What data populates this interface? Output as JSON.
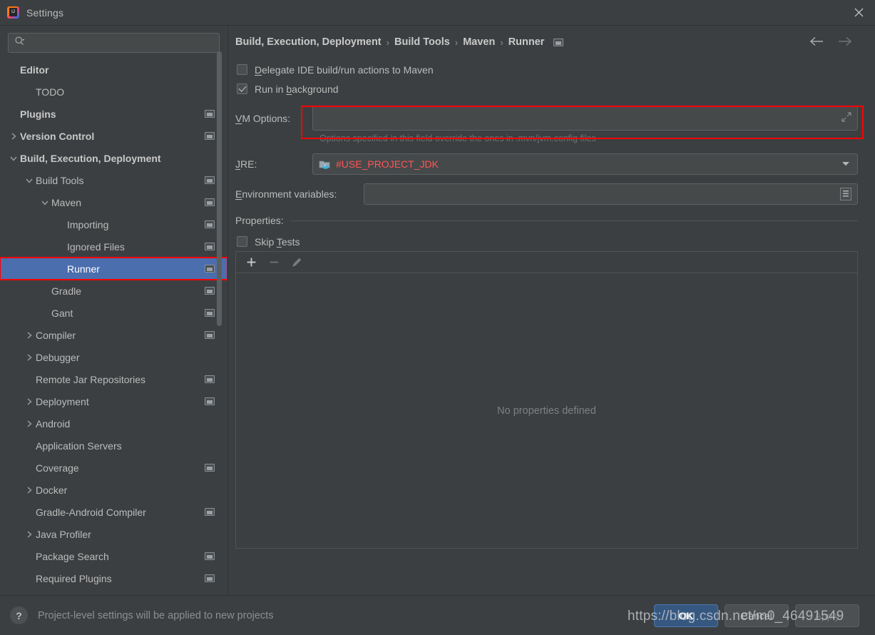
{
  "window": {
    "title": "Settings",
    "app_icon": "intellij-idea-icon",
    "close_icon": "close-icon"
  },
  "sidebar": {
    "search": {
      "placeholder": "",
      "value": "",
      "icon": "search-icon"
    },
    "items": [
      {
        "label": "Editor",
        "indent": 0,
        "bold": true,
        "arrow": "none",
        "project_icon": false
      },
      {
        "label": "TODO",
        "indent": 1,
        "bold": false,
        "arrow": "none",
        "project_icon": false
      },
      {
        "label": "Plugins",
        "indent": 0,
        "bold": true,
        "arrow": "none",
        "project_icon": true
      },
      {
        "label": "Version Control",
        "indent": 0,
        "bold": true,
        "arrow": "collapsed",
        "project_icon": true
      },
      {
        "label": "Build, Execution, Deployment",
        "indent": 0,
        "bold": true,
        "arrow": "expanded",
        "project_icon": false
      },
      {
        "label": "Build Tools",
        "indent": 1,
        "bold": false,
        "arrow": "expanded",
        "project_icon": true
      },
      {
        "label": "Maven",
        "indent": 2,
        "bold": false,
        "arrow": "expanded",
        "project_icon": true
      },
      {
        "label": "Importing",
        "indent": 3,
        "bold": false,
        "arrow": "none",
        "project_icon": true
      },
      {
        "label": "Ignored Files",
        "indent": 3,
        "bold": false,
        "arrow": "none",
        "project_icon": true
      },
      {
        "label": "Runner",
        "indent": 3,
        "bold": false,
        "arrow": "none",
        "project_icon": true,
        "selected": true,
        "highlighted": true
      },
      {
        "label": "Gradle",
        "indent": 2,
        "bold": false,
        "arrow": "none",
        "project_icon": true
      },
      {
        "label": "Gant",
        "indent": 2,
        "bold": false,
        "arrow": "none",
        "project_icon": true
      },
      {
        "label": "Compiler",
        "indent": 1,
        "bold": false,
        "arrow": "collapsed",
        "project_icon": true
      },
      {
        "label": "Debugger",
        "indent": 1,
        "bold": false,
        "arrow": "collapsed",
        "project_icon": false
      },
      {
        "label": "Remote Jar Repositories",
        "indent": 1,
        "bold": false,
        "arrow": "none",
        "project_icon": true
      },
      {
        "label": "Deployment",
        "indent": 1,
        "bold": false,
        "arrow": "collapsed",
        "project_icon": true
      },
      {
        "label": "Android",
        "indent": 1,
        "bold": false,
        "arrow": "collapsed",
        "project_icon": false
      },
      {
        "label": "Application Servers",
        "indent": 1,
        "bold": false,
        "arrow": "none",
        "project_icon": false
      },
      {
        "label": "Coverage",
        "indent": 1,
        "bold": false,
        "arrow": "none",
        "project_icon": true
      },
      {
        "label": "Docker",
        "indent": 1,
        "bold": false,
        "arrow": "collapsed",
        "project_icon": false
      },
      {
        "label": "Gradle-Android Compiler",
        "indent": 1,
        "bold": false,
        "arrow": "none",
        "project_icon": true
      },
      {
        "label": "Java Profiler",
        "indent": 1,
        "bold": false,
        "arrow": "collapsed",
        "project_icon": false
      },
      {
        "label": "Package Search",
        "indent": 1,
        "bold": false,
        "arrow": "none",
        "project_icon": true
      },
      {
        "label": "Required Plugins",
        "indent": 1,
        "bold": false,
        "arrow": "none",
        "project_icon": true
      }
    ]
  },
  "main": {
    "breadcrumb": {
      "parts": [
        "Build, Execution, Deployment",
        "Build Tools",
        "Maven",
        "Runner"
      ],
      "separator": "›",
      "trailing_icon": "project-level-settings-icon"
    },
    "nav": {
      "back_icon": "arrow-left-icon",
      "forward_icon": "arrow-right-icon"
    },
    "delegate_checkbox": {
      "label": "Delegate IDE build/run actions to Maven",
      "checked": false
    },
    "run_in_background_checkbox": {
      "label": "Run in background",
      "checked": true
    },
    "vm_options": {
      "label": "VM Options:",
      "value": "",
      "expand_icon": "expand-diagonal-icon",
      "hint": "Options specified in this field override the ones in .mvn/jvm.config files"
    },
    "jre": {
      "label": "JRE:",
      "value": "#USE_PROJECT_JDK",
      "icon": "folder-java-icon",
      "caret_icon": "chevron-down-icon"
    },
    "environment_variables": {
      "label": "Environment variables:",
      "value": "",
      "browse_icon": "list-browse-icon"
    },
    "properties": {
      "label": "Properties:",
      "skip_tests": {
        "label": "Skip Tests",
        "checked": false
      },
      "toolbar": {
        "add_icon": "plus-icon",
        "remove_icon": "minus-icon",
        "edit_icon": "pencil-icon"
      },
      "empty_text": "No properties defined"
    }
  },
  "footer": {
    "help_icon": "question-mark-icon",
    "note": "Project-level settings will be applied to new projects",
    "ok_label": "OK",
    "cancel_label": "Cancel",
    "apply_label": "Apply"
  },
  "overlay": {
    "watermark": "https://blog.csdn.net/m0_46491549",
    "highlight_color": "#ff0000"
  },
  "colors": {
    "background": "#3c3f41",
    "selection": "#4b6eaf",
    "accent": "#365880",
    "value_red": "#ff5555",
    "text": "#bbbbbb"
  }
}
